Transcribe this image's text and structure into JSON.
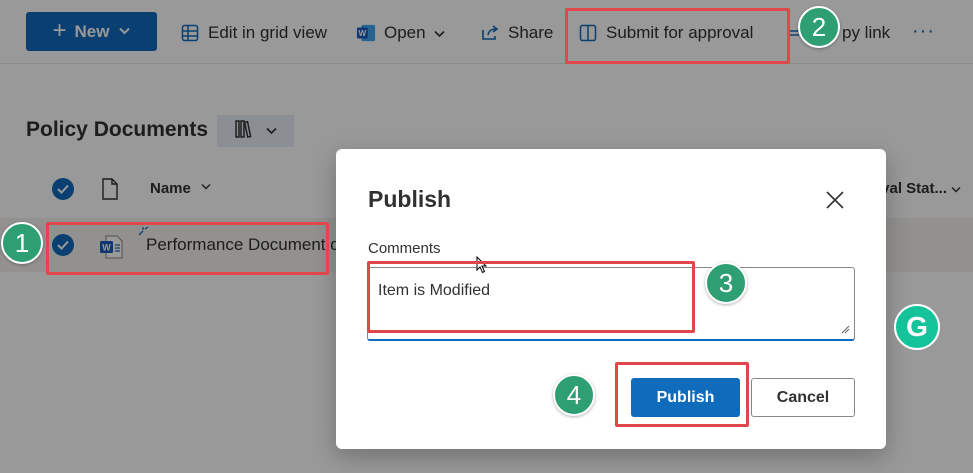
{
  "toolbar": {
    "new_label": "New",
    "edit_grid_label": "Edit in grid view",
    "open_label": "Open",
    "share_label": "Share",
    "submit_label": "Submit for approval",
    "copy_link_label": "py link",
    "more_label": "···"
  },
  "library": {
    "title": "Policy Documents",
    "columns": {
      "name": "Name",
      "approval": "oval Stat..."
    },
    "rows": [
      {
        "name": "Performance Document.d",
        "selected": true
      }
    ]
  },
  "dialog": {
    "title": "Publish",
    "comments_label": "Comments",
    "comments_value": "Item is Modified",
    "publish_label": "Publish",
    "cancel_label": "Cancel"
  },
  "annotations": {
    "steps": [
      "1",
      "2",
      "3",
      "4"
    ],
    "step_color": "#2e9e73",
    "highlight_color": "#e0474c"
  },
  "grammarly": {
    "letter": "G",
    "color": "#15c39a"
  },
  "colors": {
    "accent": "#0f6cbd"
  }
}
